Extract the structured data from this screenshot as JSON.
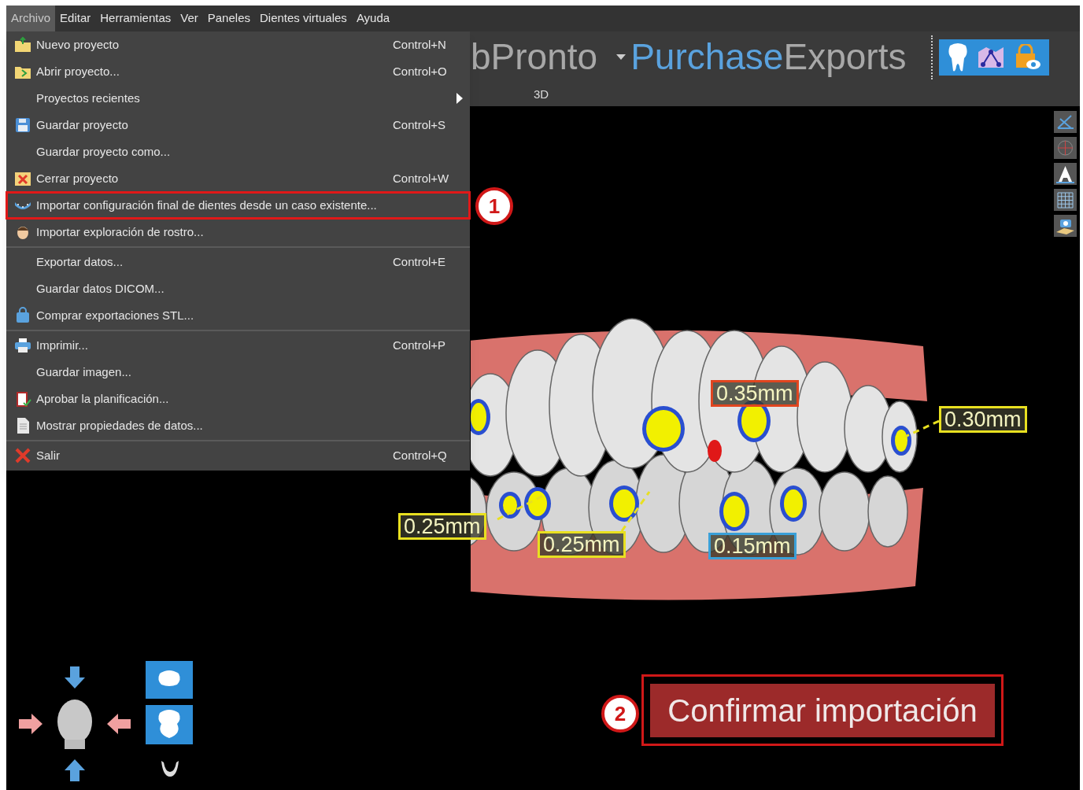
{
  "menu_bar": [
    {
      "label": "Archivo",
      "selected": true
    },
    {
      "label": "Editar",
      "selected": false
    },
    {
      "label": "Herramientas",
      "selected": false
    },
    {
      "label": "Ver",
      "selected": false
    },
    {
      "label": "Paneles",
      "selected": false
    },
    {
      "label": "Dientes virtuales",
      "selected": false
    },
    {
      "label": "Ayuda",
      "selected": false
    }
  ],
  "file_menu": {
    "items": [
      {
        "kind": "item",
        "label": "Nuevo proyecto",
        "shortcut": "Control+N",
        "submenu": false,
        "highlighted": false
      },
      {
        "kind": "item",
        "label": "Abrir proyecto...",
        "shortcut": "Control+O",
        "submenu": false,
        "highlighted": false
      },
      {
        "kind": "item",
        "label": "Proyectos recientes",
        "submenu": true,
        "highlighted": false
      },
      {
        "kind": "item",
        "label": "Guardar proyecto",
        "shortcut": "Control+S",
        "submenu": false,
        "highlighted": false
      },
      {
        "kind": "item",
        "label": "Guardar proyecto como...",
        "submenu": false,
        "highlighted": false
      },
      {
        "kind": "item",
        "label": "Cerrar proyecto",
        "shortcut": "Control+W",
        "submenu": false,
        "highlighted": false
      },
      {
        "kind": "item",
        "label": "Importar configuración final de dientes desde un caso existente...",
        "submenu": false,
        "highlighted": true
      },
      {
        "kind": "item",
        "label": "Importar exploración de rostro...",
        "submenu": false,
        "highlighted": false
      },
      {
        "kind": "separator"
      },
      {
        "kind": "item",
        "label": "Exportar datos...",
        "shortcut": "Control+E",
        "submenu": false,
        "highlighted": false
      },
      {
        "kind": "item",
        "label": "Guardar datos DICOM...",
        "submenu": false,
        "highlighted": false
      },
      {
        "kind": "item",
        "label": "Comprar exportaciones STL...",
        "submenu": false,
        "highlighted": false
      },
      {
        "kind": "separator"
      },
      {
        "kind": "item",
        "label": "Imprimir...",
        "shortcut": "Control+P",
        "submenu": false,
        "highlighted": false
      },
      {
        "kind": "item",
        "label": "Guardar imagen...",
        "submenu": false,
        "highlighted": false
      },
      {
        "kind": "item",
        "label": "Aprobar la planificación...",
        "submenu": false,
        "highlighted": false
      },
      {
        "kind": "item",
        "label": "Mostrar propiedades de datos...",
        "submenu": false,
        "highlighted": false
      },
      {
        "kind": "separator"
      },
      {
        "kind": "item",
        "label": "Salir",
        "shortcut": "Control+Q",
        "submenu": false,
        "highlighted": false
      }
    ]
  },
  "brand": {
    "product": "bPronto",
    "module_parts": [
      "Purchase",
      "Exports"
    ]
  },
  "view": {
    "title": "3D"
  },
  "measurements": [
    {
      "value": "0.35mm",
      "color": "#e0451f"
    },
    {
      "value": "0.30mm",
      "color": "#e8e020"
    },
    {
      "value": "0.25mm",
      "color": "#e8e020"
    },
    {
      "value": "0.25mm",
      "color": "#e8e020"
    },
    {
      "value": "0.15mm",
      "color": "#3aa0d8"
    }
  ],
  "confirm_button": {
    "label": "Confirmar importación"
  },
  "callouts": [
    {
      "number": "1"
    },
    {
      "number": "2"
    }
  ]
}
